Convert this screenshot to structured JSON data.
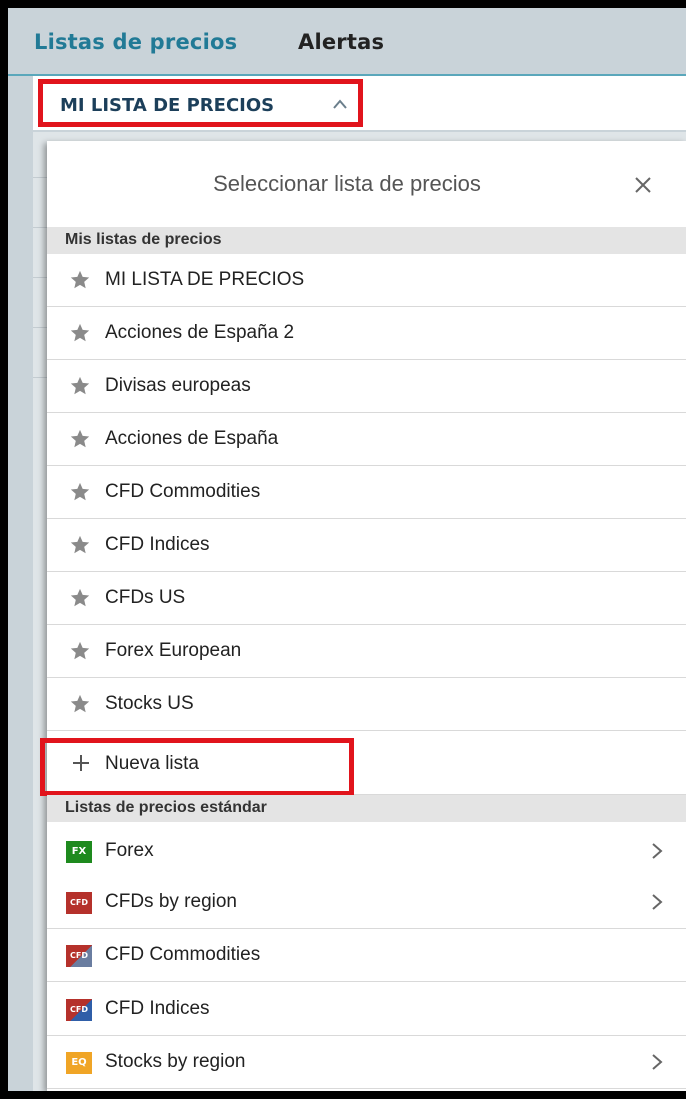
{
  "tabs": {
    "prices": "Listas de precios",
    "alerts": "Alertas"
  },
  "list_selector": {
    "label": "MI LISTA DE PRECIOS"
  },
  "panel": {
    "title": "Seleccionar lista de precios",
    "my_lists_header": "Mis listas de precios",
    "my_lists": [
      "MI LISTA DE PRECIOS",
      "Acciones de España 2",
      "Divisas europeas",
      "Acciones de España",
      "CFD Commodities",
      "CFD Indices",
      "CFDs US",
      "Forex European",
      "Stocks US"
    ],
    "new_list": "Nueva lista",
    "standard_header": "Listas de precios estándar",
    "standard_lists": [
      {
        "label": "Forex",
        "badge": "FX",
        "icon": "fx-icon",
        "has_submenu": true
      },
      {
        "label": "CFDs by region",
        "badge": "CFD",
        "icon": "cfd-icon",
        "has_submenu": true
      },
      {
        "label": "CFD Commodities",
        "badge": "CFD",
        "icon": "cfd-commodities-icon",
        "has_submenu": false
      },
      {
        "label": "CFD Indices",
        "badge": "CFD",
        "icon": "cfd-indices-icon",
        "has_submenu": false
      },
      {
        "label": "Stocks by region",
        "badge": "EQ",
        "icon": "eq-icon",
        "has_submenu": true
      }
    ]
  },
  "colors": {
    "highlight": "#e1141c",
    "tab_active": "#217a96",
    "star": "#8a8a8a"
  }
}
